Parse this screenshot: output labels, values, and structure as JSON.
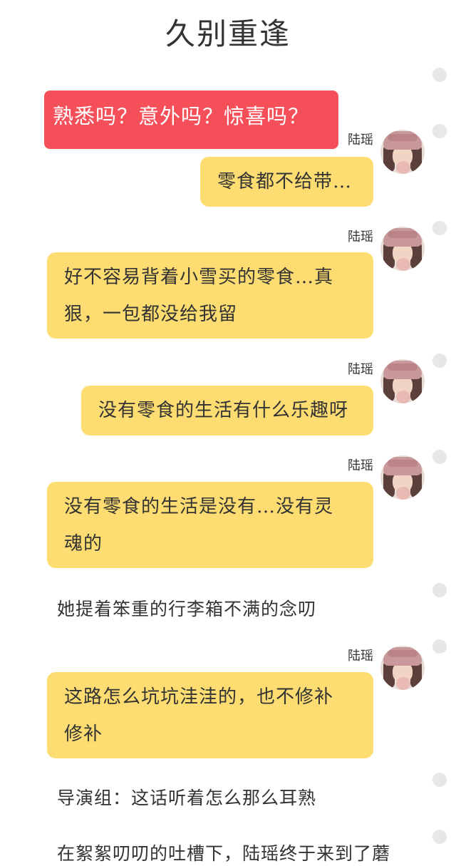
{
  "page": {
    "title": "久别重逢"
  },
  "dialogues": [
    {
      "speaker": "陆瑶",
      "text": "熟悉吗？意外吗？惊喜吗？"
    },
    {
      "speaker": "",
      "text": "零食都不给带…"
    },
    {
      "speaker": "陆瑶",
      "text": "好不容易背着小雪买的零食…真狠，一包都没给我留"
    },
    {
      "speaker": "陆瑶",
      "text": "没有零食的生活有什么乐趣呀"
    },
    {
      "speaker": "陆瑶",
      "text": "没有零食的生活是没有…没有灵魂的"
    },
    {
      "speaker": "陆瑶",
      "text": "这路怎么坑坑洼洼的，也不修补修补"
    }
  ],
  "bubble_lines": {
    "b3": [
      "好不容易背着小雪买的零食…真",
      "狠，一包都没给我留"
    ],
    "b5": [
      "没有零食的生活是没有…没有灵",
      "魂的"
    ],
    "b6": [
      "这路怎么坑坑洼洼的，也不修补",
      "修补"
    ]
  },
  "narrations": [
    "她提着笨重的行李箱不满的念叨",
    "导演组：这话听着怎么那么耳熟",
    "在絮絮叨叨的吐槽下，陆瑶终于来到了蘑"
  ],
  "colors": {
    "bubble": "#fddd72",
    "highlight_bubble": "#f5505a",
    "dot": "#e7e7e9"
  }
}
